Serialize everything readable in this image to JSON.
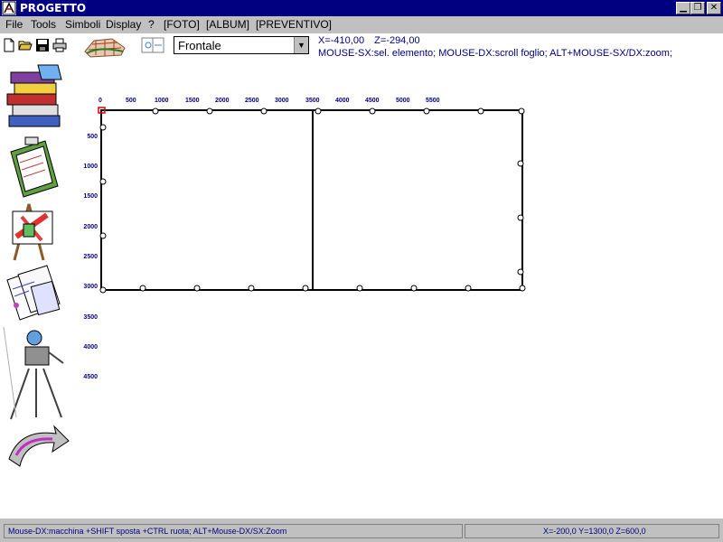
{
  "window": {
    "title": "PROGETTO"
  },
  "menu": {
    "items": [
      "File",
      "Tools",
      "Simboli",
      "Display",
      "?",
      "[FOTO]",
      "[ALBUM]",
      "[PREVENTIVO]"
    ]
  },
  "view": {
    "selected": "Frontale"
  },
  "coords": {
    "x": "X=-410,00",
    "z": "Z=-294,00"
  },
  "hint": "MOUSE-SX:sel. elemento; MOUSE-DX:scroll foglio; ALT+MOUSE-SX/DX:zoom;",
  "ruler_x": [
    "0",
    "500",
    "1000",
    "1500",
    "2000",
    "2500",
    "3000",
    "3500",
    "4000",
    "4500",
    "5000",
    "5500"
  ],
  "ruler_z": [
    "500",
    "1000",
    "1500",
    "2000",
    "2500",
    "3000",
    "3500",
    "4000",
    "4500"
  ],
  "status": {
    "left": "Mouse-DX:macchina +SHIFT sposta +CTRL ruota; ALT+Mouse-DX/SX:Zoom",
    "right": "X=-200,0 Y=1300,0 Z=600,0"
  }
}
